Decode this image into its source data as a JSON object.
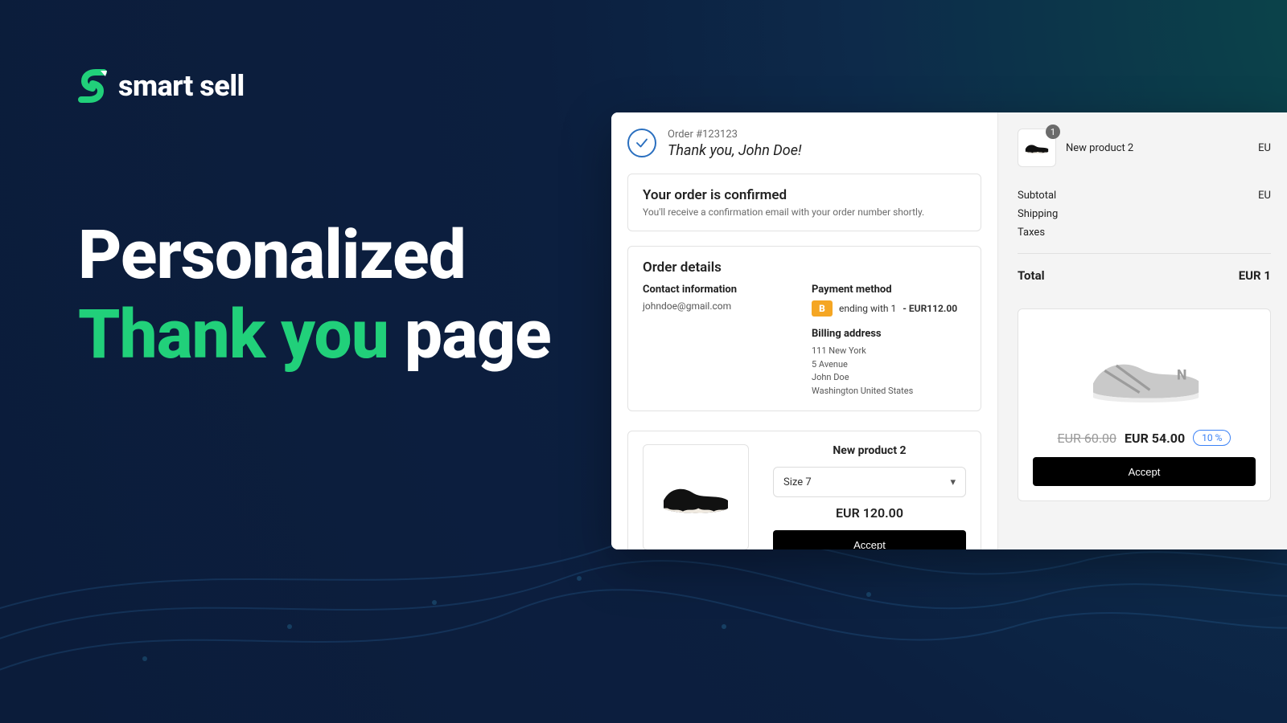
{
  "brand": {
    "name": "smart sell",
    "accent": "#21d07a"
  },
  "headline": {
    "l1": "Personalized",
    "l2_accent": "Thank you",
    "l2_rest": "page"
  },
  "order": {
    "number_label": "Order #123123",
    "thanks": "Thank you, John Doe!",
    "confirmed_title": "Your order is confirmed",
    "confirmed_sub": "You'll receive a confirmation email with your order number shortly.",
    "details_title": "Order details",
    "contact_head": "Contact information",
    "contact_email": "johndoe@gmail.com",
    "payment_head": "Payment method",
    "payment_badge": "B",
    "payment_ending": "ending with 1",
    "payment_amount": "- EUR112.00",
    "billing_head": "Billing address",
    "billing_lines": [
      "111 New York",
      "5 Avenue",
      "John Doe",
      "Washington United States"
    ]
  },
  "offer_main": {
    "name": "New product 2",
    "size_label": "Size 7",
    "price": "EUR 120.00",
    "accept": "Accept"
  },
  "cart": {
    "qty": "1",
    "name": "New product 2",
    "price_right": "EU",
    "rows": {
      "subtotal_label": "Subtotal",
      "subtotal_value": "EU",
      "shipping_label": "Shipping",
      "taxes_label": "Taxes",
      "total_label": "Total",
      "total_value": "EUR 1"
    }
  },
  "offer_side": {
    "old_price": "EUR 60.00",
    "new_price": "EUR 54.00",
    "discount": "10 %",
    "accept": "Accept"
  }
}
